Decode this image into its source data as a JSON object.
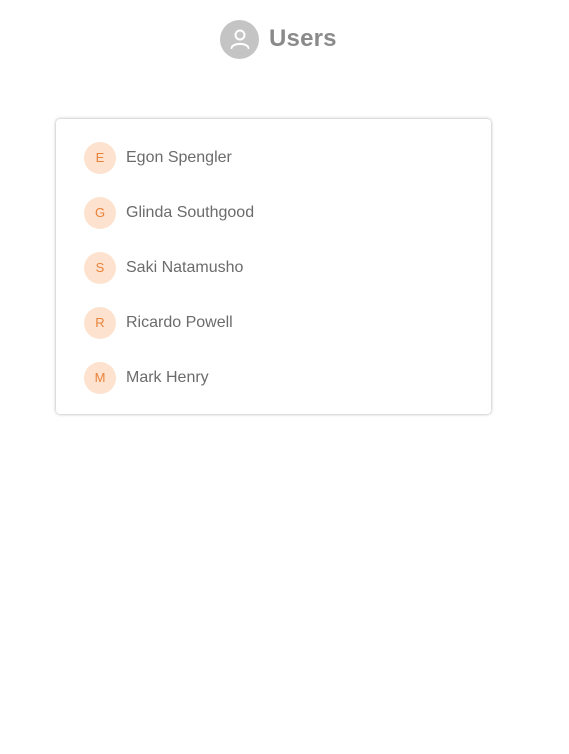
{
  "header": {
    "title": "Users",
    "icon": "user-icon"
  },
  "colors": {
    "avatar_bg": "#fde2cf",
    "avatar_text": "#e8833a",
    "header_icon_bg": "#c4c4c4",
    "text": "#6b6b6b"
  },
  "users": [
    {
      "initial": "E",
      "name": "Egon Spengler"
    },
    {
      "initial": "G",
      "name": "Glinda Southgood"
    },
    {
      "initial": "S",
      "name": "Saki Natamusho"
    },
    {
      "initial": "R",
      "name": "Ricardo Powell"
    },
    {
      "initial": "M",
      "name": "Mark Henry"
    }
  ]
}
